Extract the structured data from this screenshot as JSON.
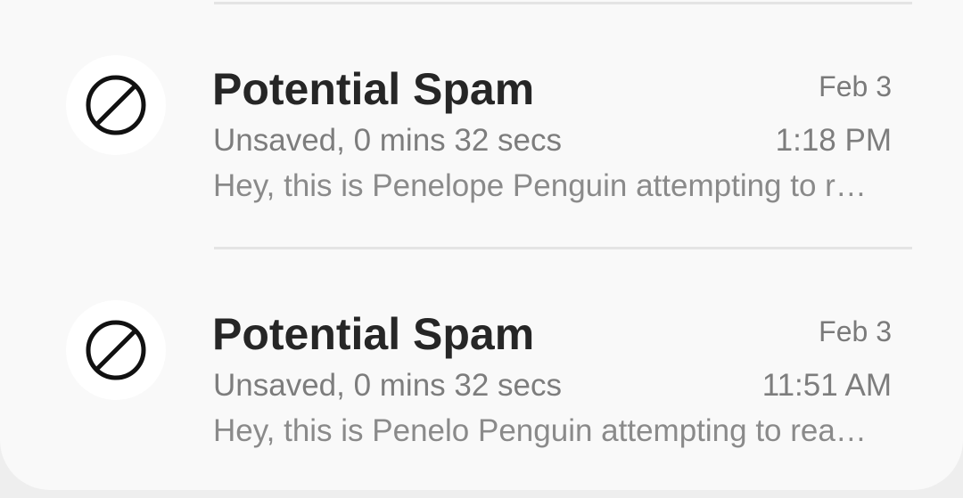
{
  "calls": [
    {
      "title": "Potential Spam",
      "date": "Feb 3",
      "status": "Unsaved, 0 mins 32 secs",
      "time": "1:18 PM",
      "preview": "Hey, this is Penelope Penguin attempting to r…",
      "icon": "block-icon"
    },
    {
      "title": "Potential Spam",
      "date": "Feb 3",
      "status": "Unsaved, 0 mins 32 secs",
      "time": "11:51 AM",
      "preview": "Hey, this is Penelo Penguin attempting to rea…",
      "icon": "block-icon"
    }
  ]
}
